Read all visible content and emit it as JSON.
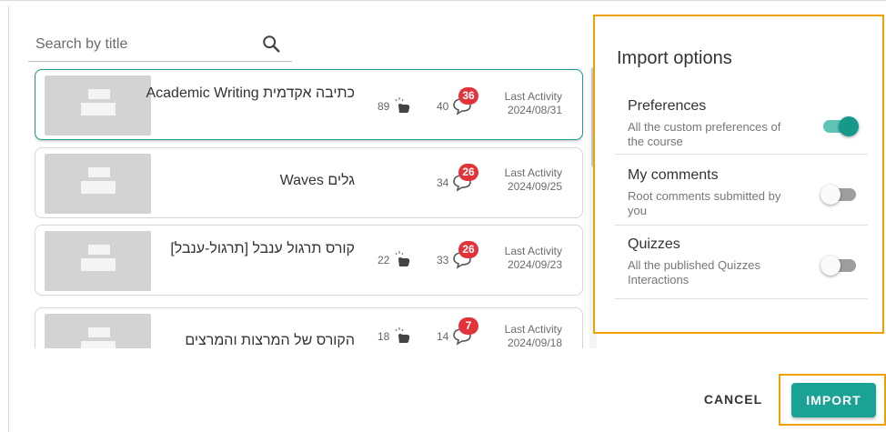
{
  "search": {
    "placeholder": "Search by title",
    "icon": "search-icon"
  },
  "courses": [
    {
      "title": "כתיבה אקדמית  Academic Writing",
      "likes": "89",
      "comments": "40",
      "badge": "36",
      "activity_label": "Last Activity",
      "activity_date": "2024/08/31",
      "selected": true
    },
    {
      "title": "גלים  Waves",
      "likes": "",
      "comments": "34",
      "badge": "26",
      "activity_label": "Last Activity",
      "activity_date": "2024/09/25",
      "selected": false
    },
    {
      "title": "קורס תרגול ענבל [תרגול-ענבל]",
      "likes": "22",
      "comments": "33",
      "badge": "26",
      "activity_label": "Last Activity",
      "activity_date": "2024/09/23",
      "selected": false
    },
    {
      "title": "הקורס של המרצות והמרצים",
      "likes": "18",
      "comments": "14",
      "badge": "7",
      "activity_label": "Last Activity",
      "activity_date": "2024/09/18",
      "selected": false
    }
  ],
  "import_options": {
    "title": "Import options",
    "items": [
      {
        "name": "Preferences",
        "description": "All the custom preferences of the course",
        "enabled": true
      },
      {
        "name": "My comments",
        "description": "Root comments submitted by you",
        "enabled": false
      },
      {
        "name": "Quizzes",
        "description": "All the published Quizzes Interactions",
        "enabled": false
      }
    ]
  },
  "footer": {
    "cancel_label": "CANCEL",
    "import_label": "IMPORT"
  },
  "colors": {
    "accent": "#1aa394",
    "highlight": "#f0a000",
    "badge": "#e2333a"
  }
}
